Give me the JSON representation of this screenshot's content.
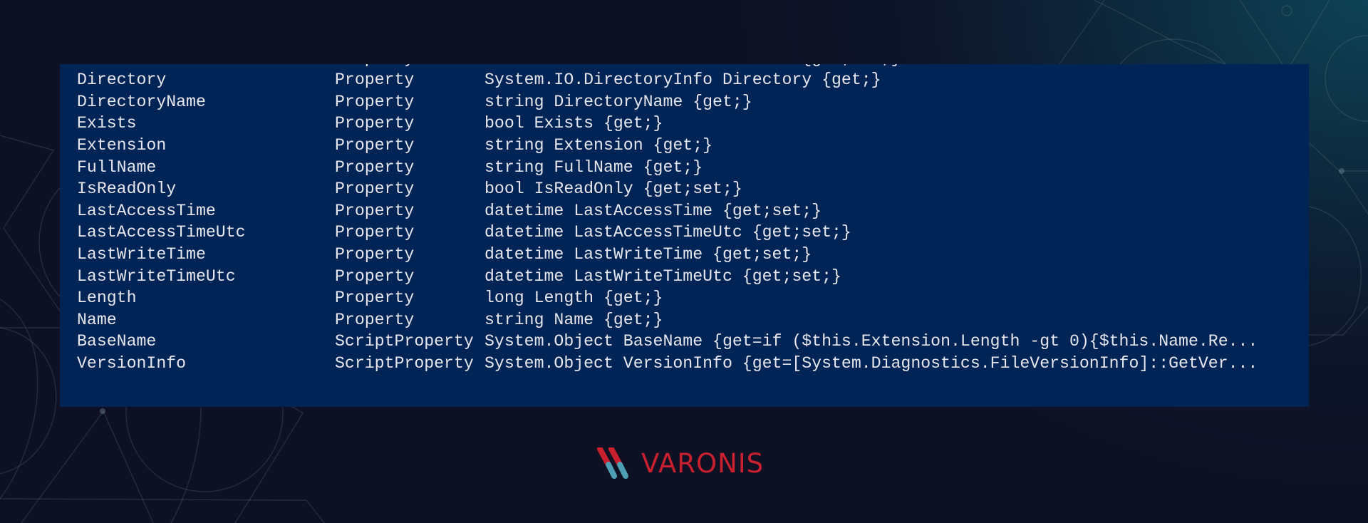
{
  "terminal": {
    "background": "#012456",
    "text_color": "#e6e7ec",
    "partial_top_row": {
      "name": "",
      "member_type": "Property",
      "definition": "                                {get;set;}"
    },
    "rows": [
      {
        "name": "Directory",
        "member_type": "Property",
        "definition": "System.IO.DirectoryInfo Directory {get;}"
      },
      {
        "name": "DirectoryName",
        "member_type": "Property",
        "definition": "string DirectoryName {get;}"
      },
      {
        "name": "Exists",
        "member_type": "Property",
        "definition": "bool Exists {get;}"
      },
      {
        "name": "Extension",
        "member_type": "Property",
        "definition": "string Extension {get;}"
      },
      {
        "name": "FullName",
        "member_type": "Property",
        "definition": "string FullName {get;}"
      },
      {
        "name": "IsReadOnly",
        "member_type": "Property",
        "definition": "bool IsReadOnly {get;set;}"
      },
      {
        "name": "LastAccessTime",
        "member_type": "Property",
        "definition": "datetime LastAccessTime {get;set;}"
      },
      {
        "name": "LastAccessTimeUtc",
        "member_type": "Property",
        "definition": "datetime LastAccessTimeUtc {get;set;}"
      },
      {
        "name": "LastWriteTime",
        "member_type": "Property",
        "definition": "datetime LastWriteTime {get;set;}"
      },
      {
        "name": "LastWriteTimeUtc",
        "member_type": "Property",
        "definition": "datetime LastWriteTimeUtc {get;set;}"
      },
      {
        "name": "Length",
        "member_type": "Property",
        "definition": "long Length {get;}"
      },
      {
        "name": "Name",
        "member_type": "Property",
        "definition": "string Name {get;}"
      },
      {
        "name": "BaseName",
        "member_type": "ScriptProperty",
        "definition": "System.Object BaseName {get=if ($this.Extension.Length -gt 0){$this.Name.Re..."
      },
      {
        "name": "VersionInfo",
        "member_type": "ScriptProperty",
        "definition": "System.Object VersionInfo {get=[System.Diagnostics.FileVersionInfo]::GetVer..."
      }
    ]
  },
  "brand": {
    "logo_text": "VARONIS",
    "logo_icon": "varonis-stripes-icon",
    "red": "#c8202f",
    "teal": "#4f9fb4"
  }
}
